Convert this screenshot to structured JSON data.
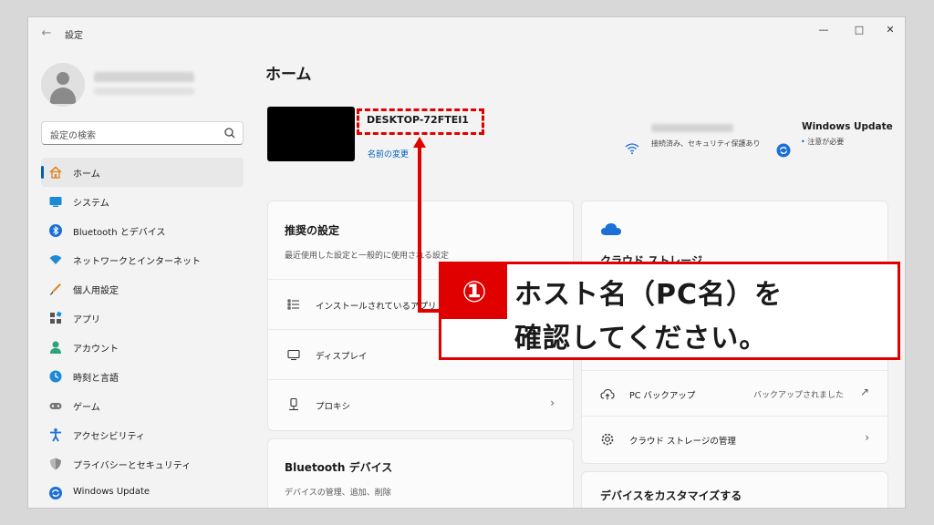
{
  "window": {
    "title": "設定",
    "controls": {
      "minimize": "—",
      "maximize": "□",
      "close": "✕"
    }
  },
  "sidebar": {
    "search_placeholder": "設定の検索",
    "items": [
      {
        "label": "ホーム",
        "icon": "home-icon",
        "active": true
      },
      {
        "label": "システム",
        "icon": "system-icon"
      },
      {
        "label": "Bluetooth とデバイス",
        "icon": "bluetooth-icon"
      },
      {
        "label": "ネットワークとインターネット",
        "icon": "network-icon"
      },
      {
        "label": "個人用設定",
        "icon": "personalization-icon"
      },
      {
        "label": "アプリ",
        "icon": "apps-icon"
      },
      {
        "label": "アカウント",
        "icon": "account-icon"
      },
      {
        "label": "時刻と言語",
        "icon": "time-language-icon"
      },
      {
        "label": "ゲーム",
        "icon": "gaming-icon"
      },
      {
        "label": "アクセシビリティ",
        "icon": "accessibility-icon"
      },
      {
        "label": "プライバシーとセキュリティ",
        "icon": "privacy-icon"
      },
      {
        "label": "Windows Update",
        "icon": "windows-update-icon"
      }
    ]
  },
  "main": {
    "page_title": "ホーム",
    "pc_name": "DESKTOP-72FTEI1",
    "rename_link": "名前の変更",
    "wifi_status": "接続済み、セキュリティ保護あり",
    "windows_update": {
      "title": "Windows Update",
      "status": "注意が必要",
      "bullet": "•"
    },
    "recommended": {
      "title": "推奨の設定",
      "subtitle": "最近使用した設定と一般的に使用される設定",
      "rows": [
        {
          "label": "インストールされているアプリ"
        },
        {
          "label": "ディスプレイ"
        },
        {
          "label": "プロキシ",
          "chevron": "›"
        }
      ]
    },
    "bluetooth": {
      "title": "Bluetooth デバイス",
      "subtitle": "デバイスの管理、追加、削除"
    },
    "cloud": {
      "title": "クラウド ストレージ",
      "rows": [
        {
          "label": "PC バックアップ",
          "value": "バックアップされました",
          "chevron": "↗"
        },
        {
          "label": "クラウド ストレージの管理",
          "chevron": "›"
        }
      ]
    },
    "customize": {
      "title": "デバイスをカスタマイズする"
    }
  },
  "annotation": {
    "number": "①",
    "line1": "ホスト名（PC名）を",
    "line2": "確認してください。"
  },
  "colors": {
    "accent": "#005fb8",
    "annotation_red": "#e00000"
  }
}
